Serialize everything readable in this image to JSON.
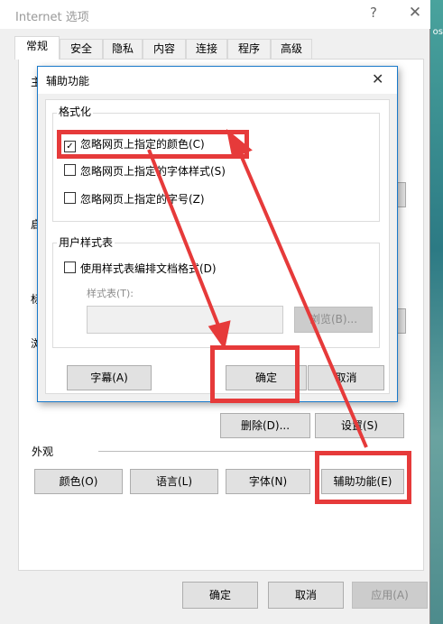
{
  "window": {
    "title": "Internet 选项",
    "help_glyph": "?",
    "close_glyph": "✕",
    "tabs": [
      {
        "label": "常规",
        "active": true
      },
      {
        "label": "安全"
      },
      {
        "label": "隐私"
      },
      {
        "label": "内容"
      },
      {
        "label": "连接"
      },
      {
        "label": "程序"
      },
      {
        "label": "高级"
      }
    ],
    "clipped_labels": [
      "主",
      "启",
      "标",
      "浏"
    ],
    "delete_button": "删除(D)...",
    "settings_button": "设置(S)",
    "appearance_label": "外观",
    "appearance_buttons": [
      "颜色(O)",
      "语言(L)",
      "字体(N)",
      "辅助功能(E)"
    ],
    "footer_buttons": {
      "ok": "确定",
      "cancel": "取消",
      "apply": "应用(A)"
    }
  },
  "dialog": {
    "title": "辅助功能",
    "close_glyph": "✕",
    "format_group": {
      "title": "格式化",
      "options": [
        {
          "label": "忽略网页上指定的颜色(C)",
          "checked": true
        },
        {
          "label": "忽略网页上指定的字体样式(S)",
          "checked": false
        },
        {
          "label": "忽略网页上指定的字号(Z)",
          "checked": false
        }
      ]
    },
    "style_group": {
      "title": "用户样式表",
      "option": {
        "label": "使用样式表编排文档格式(D)",
        "checked": false
      },
      "field_label": "样式表(T):",
      "field_value": "",
      "browse_button": "浏览(B)..."
    },
    "captions_button": "字幕(A)",
    "ok_button": "确定",
    "cancel_button": "取消"
  },
  "colors": {
    "annotation_red": "#e63a3a",
    "dialog_border": "#1979ca"
  }
}
